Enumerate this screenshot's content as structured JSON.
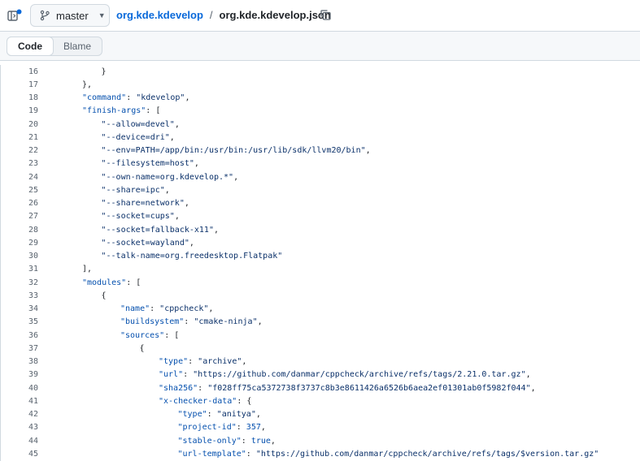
{
  "header": {
    "branch": "master",
    "repo": "org.kde.kdevelop",
    "separator": "/",
    "file": "org.kde.kdevelop.json"
  },
  "view_tabs": [
    "Code",
    "Blame"
  ],
  "code": {
    "lines": [
      {
        "n": "16",
        "indent": 2,
        "t": [
          [
            "p",
            "}"
          ]
        ]
      },
      {
        "n": "17",
        "indent": 1,
        "t": [
          [
            "p",
            "},"
          ]
        ]
      },
      {
        "n": "18",
        "indent": 1,
        "t": [
          [
            "k",
            "\"command\""
          ],
          [
            "p",
            ": "
          ],
          [
            "s",
            "\"kdevelop\""
          ],
          [
            "p",
            ","
          ]
        ]
      },
      {
        "n": "19",
        "indent": 1,
        "t": [
          [
            "k",
            "\"finish-args\""
          ],
          [
            "p",
            ": ["
          ]
        ]
      },
      {
        "n": "20",
        "indent": 2,
        "t": [
          [
            "s",
            "\"--allow=devel\""
          ],
          [
            "p",
            ","
          ]
        ]
      },
      {
        "n": "21",
        "indent": 2,
        "t": [
          [
            "s",
            "\"--device=dri\""
          ],
          [
            "p",
            ","
          ]
        ]
      },
      {
        "n": "22",
        "indent": 2,
        "t": [
          [
            "s",
            "\"--env=PATH=/app/bin:/usr/bin:/usr/lib/sdk/llvm20/bin\""
          ],
          [
            "p",
            ","
          ]
        ]
      },
      {
        "n": "23",
        "indent": 2,
        "t": [
          [
            "s",
            "\"--filesystem=host\""
          ],
          [
            "p",
            ","
          ]
        ]
      },
      {
        "n": "24",
        "indent": 2,
        "t": [
          [
            "s",
            "\"--own-name=org.kdevelop.*\""
          ],
          [
            "p",
            ","
          ]
        ]
      },
      {
        "n": "25",
        "indent": 2,
        "t": [
          [
            "s",
            "\"--share=ipc\""
          ],
          [
            "p",
            ","
          ]
        ]
      },
      {
        "n": "26",
        "indent": 2,
        "t": [
          [
            "s",
            "\"--share=network\""
          ],
          [
            "p",
            ","
          ]
        ]
      },
      {
        "n": "27",
        "indent": 2,
        "t": [
          [
            "s",
            "\"--socket=cups\""
          ],
          [
            "p",
            ","
          ]
        ]
      },
      {
        "n": "28",
        "indent": 2,
        "t": [
          [
            "s",
            "\"--socket=fallback-x11\""
          ],
          [
            "p",
            ","
          ]
        ]
      },
      {
        "n": "29",
        "indent": 2,
        "t": [
          [
            "s",
            "\"--socket=wayland\""
          ],
          [
            "p",
            ","
          ]
        ]
      },
      {
        "n": "30",
        "indent": 2,
        "t": [
          [
            "s",
            "\"--talk-name=org.freedesktop.Flatpak\""
          ]
        ]
      },
      {
        "n": "31",
        "indent": 1,
        "t": [
          [
            "p",
            "],"
          ]
        ]
      },
      {
        "n": "32",
        "indent": 1,
        "t": [
          [
            "k",
            "\"modules\""
          ],
          [
            "p",
            ": ["
          ]
        ]
      },
      {
        "n": "33",
        "indent": 2,
        "t": [
          [
            "p",
            "{"
          ]
        ]
      },
      {
        "n": "34",
        "indent": 3,
        "t": [
          [
            "k",
            "\"name\""
          ],
          [
            "p",
            ": "
          ],
          [
            "s",
            "\"cppcheck\""
          ],
          [
            "p",
            ","
          ]
        ]
      },
      {
        "n": "35",
        "indent": 3,
        "t": [
          [
            "k",
            "\"buildsystem\""
          ],
          [
            "p",
            ": "
          ],
          [
            "s",
            "\"cmake-ninja\""
          ],
          [
            "p",
            ","
          ]
        ]
      },
      {
        "n": "36",
        "indent": 3,
        "t": [
          [
            "k",
            "\"sources\""
          ],
          [
            "p",
            ": ["
          ]
        ]
      },
      {
        "n": "37",
        "indent": 4,
        "t": [
          [
            "p",
            "{"
          ]
        ]
      },
      {
        "n": "38",
        "indent": 5,
        "t": [
          [
            "k",
            "\"type\""
          ],
          [
            "p",
            ": "
          ],
          [
            "s",
            "\"archive\""
          ],
          [
            "p",
            ","
          ]
        ]
      },
      {
        "n": "39",
        "indent": 5,
        "t": [
          [
            "k",
            "\"url\""
          ],
          [
            "p",
            ": "
          ],
          [
            "s",
            "\"https://github.com/danmar/cppcheck/archive/refs/tags/2.21.0.tar.gz\""
          ],
          [
            "p",
            ","
          ]
        ]
      },
      {
        "n": "40",
        "indent": 5,
        "t": [
          [
            "k",
            "\"sha256\""
          ],
          [
            "p",
            ": "
          ],
          [
            "s",
            "\"f028ff75ca5372738f3737c8b3e8611426a6526b6aea2ef01301ab0f5982f044\""
          ],
          [
            "p",
            ","
          ]
        ]
      },
      {
        "n": "41",
        "indent": 5,
        "t": [
          [
            "k",
            "\"x-checker-data\""
          ],
          [
            "p",
            ": {"
          ]
        ]
      },
      {
        "n": "42",
        "indent": 6,
        "t": [
          [
            "k",
            "\"type\""
          ],
          [
            "p",
            ": "
          ],
          [
            "s",
            "\"anitya\""
          ],
          [
            "p",
            ","
          ]
        ]
      },
      {
        "n": "43",
        "indent": 6,
        "t": [
          [
            "k",
            "\"project-id\""
          ],
          [
            "p",
            ": "
          ],
          [
            "n",
            "357"
          ],
          [
            "p",
            ","
          ]
        ]
      },
      {
        "n": "44",
        "indent": 6,
        "t": [
          [
            "k",
            "\"stable-only\""
          ],
          [
            "p",
            ": "
          ],
          [
            "n",
            "true"
          ],
          [
            "p",
            ","
          ]
        ]
      },
      {
        "n": "45",
        "indent": 6,
        "t": [
          [
            "k",
            "\"url-template\""
          ],
          [
            "p",
            ": "
          ],
          [
            "s",
            "\"https://github.com/danmar/cppcheck/archive/refs/tags/$version.tar.gz\""
          ]
        ]
      }
    ]
  }
}
